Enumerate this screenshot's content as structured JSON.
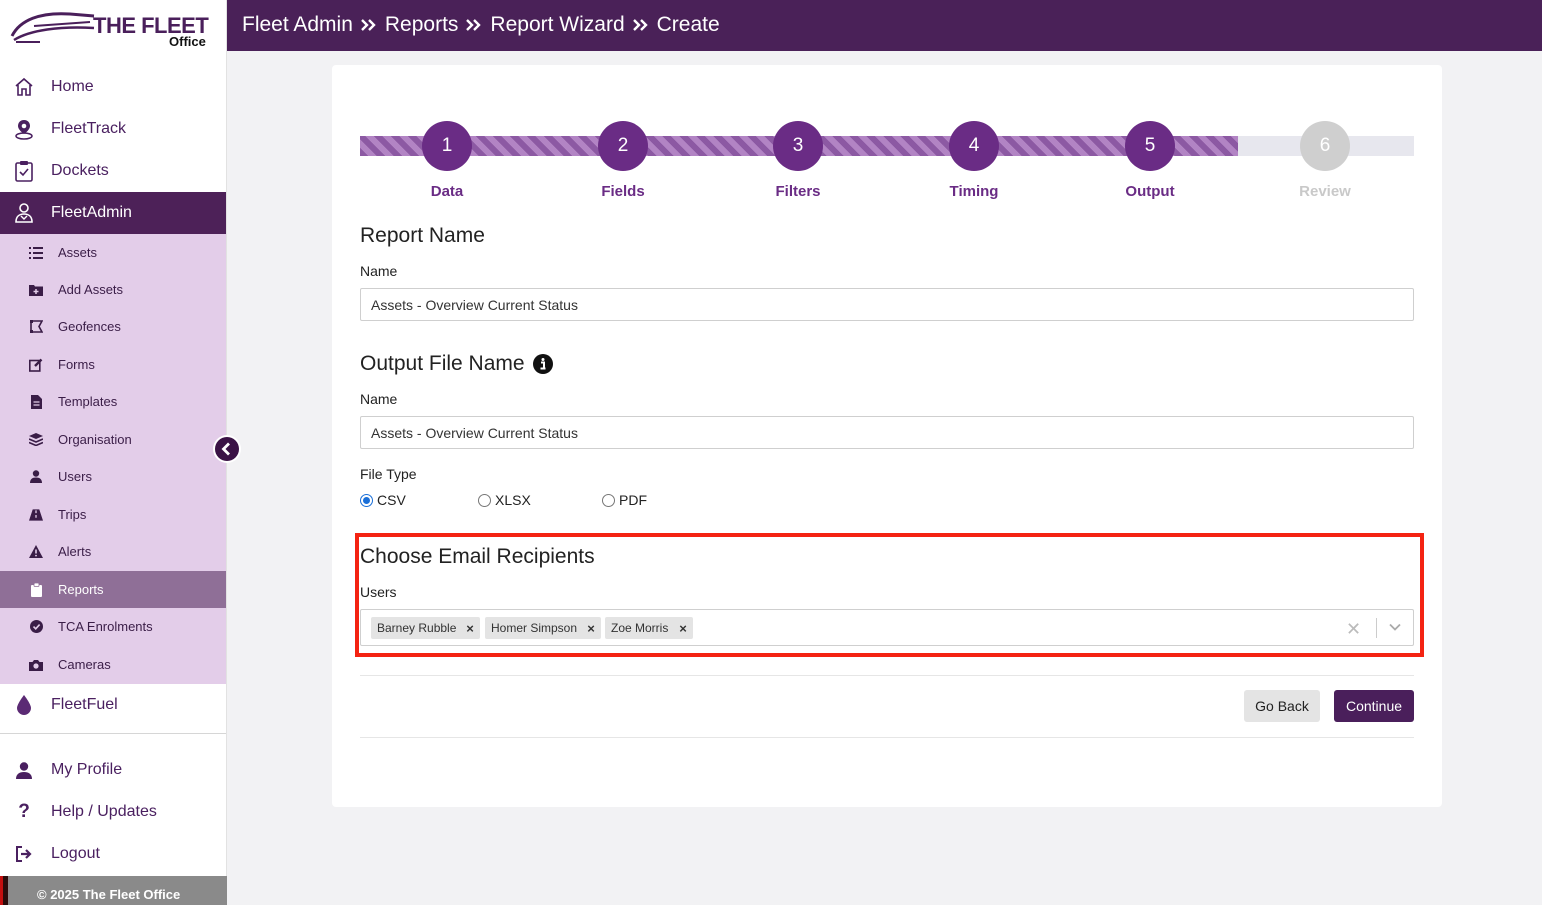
{
  "brand": {
    "title": "THE FLEET",
    "subtitle": "Office"
  },
  "header": {
    "breadcrumbs": [
      "Fleet Admin",
      "Reports",
      "Report Wizard",
      "Create"
    ]
  },
  "sidebar": {
    "main_top": [
      {
        "label": "Home",
        "icon": "home-icon"
      },
      {
        "label": "FleetTrack",
        "icon": "map-pin-icon"
      },
      {
        "label": "Dockets",
        "icon": "clipboard-check-icon"
      },
      {
        "label": "FleetAdmin",
        "icon": "user-group-icon",
        "active": true
      }
    ],
    "sub_items": [
      {
        "label": "Assets",
        "icon": "list-icon"
      },
      {
        "label": "Add Assets",
        "icon": "folder-plus-icon"
      },
      {
        "label": "Geofences",
        "icon": "geofence-icon"
      },
      {
        "label": "Forms",
        "icon": "edit-icon"
      },
      {
        "label": "Templates",
        "icon": "file-icon"
      },
      {
        "label": "Organisation",
        "icon": "layers-icon"
      },
      {
        "label": "Users",
        "icon": "user-icon"
      },
      {
        "label": "Trips",
        "icon": "road-icon"
      },
      {
        "label": "Alerts",
        "icon": "warning-icon"
      },
      {
        "label": "Reports",
        "icon": "clipboard-icon",
        "active": true
      },
      {
        "label": "TCA Enrolments",
        "icon": "check-circle-icon"
      },
      {
        "label": "Cameras",
        "icon": "camera-icon"
      }
    ],
    "fleetfuel": {
      "label": "FleetFuel",
      "icon": "droplet-icon"
    },
    "bottom": [
      {
        "label": "My Profile",
        "icon": "user-icon"
      },
      {
        "label": "Help / Updates",
        "icon": "question-icon"
      },
      {
        "label": "Logout",
        "icon": "logout-icon"
      }
    ],
    "footer": "© 2025 The Fleet Office"
  },
  "stepper": {
    "steps": [
      {
        "num": "1",
        "label": "Data",
        "state": "done"
      },
      {
        "num": "2",
        "label": "Fields",
        "state": "done"
      },
      {
        "num": "3",
        "label": "Filters",
        "state": "done"
      },
      {
        "num": "4",
        "label": "Timing",
        "state": "done"
      },
      {
        "num": "5",
        "label": "Output",
        "state": "current"
      },
      {
        "num": "6",
        "label": "Review",
        "state": "pending"
      }
    ],
    "progress_fraction": 0.833,
    "fill_color": "#8c59a3",
    "circle_color": "#6a2c85"
  },
  "report_name": {
    "title": "Report Name",
    "label": "Name",
    "value": "Assets - Overview Current Status"
  },
  "output_file": {
    "title": "Output File Name",
    "info_icon": "info-icon",
    "label": "Name",
    "value": "Assets - Overview Current Status",
    "file_type_label": "File Type",
    "options": [
      "CSV",
      "XLSX",
      "PDF"
    ],
    "selected": "CSV"
  },
  "email_recipients": {
    "title": "Choose Email Recipients",
    "label": "Users",
    "selected_users": [
      "Barney Rubble",
      "Homer Simpson",
      "Zoe Morris"
    ],
    "highlight_color": "#f42312"
  },
  "actions": {
    "back": "Go Back",
    "continue": "Continue"
  },
  "colors": {
    "brand": "#4a2158",
    "subnav_bg": "#e3cde9",
    "subnav_active": "#8f6f97"
  }
}
